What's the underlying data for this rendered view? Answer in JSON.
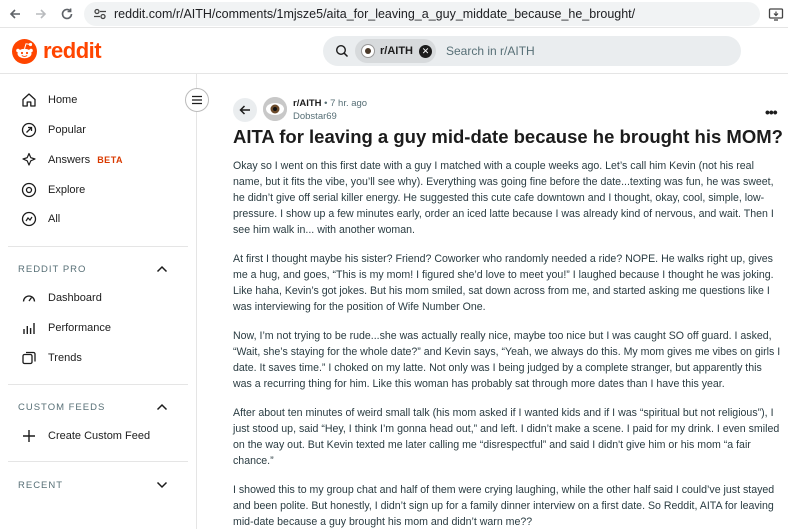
{
  "browser": {
    "url": "reddit.com/r/AITH/comments/1mjsze5/aita_for_leaving_a_guy_middate_because_he_brought/"
  },
  "header": {
    "logo_text": "reddit",
    "search_chip": "r/AITH",
    "search_placeholder": "Search in r/AITH"
  },
  "sidebar": {
    "items": [
      {
        "label": "Home",
        "icon": "home-icon"
      },
      {
        "label": "Popular",
        "icon": "popular-icon"
      },
      {
        "label": "Answers",
        "icon": "answers-icon",
        "badge": "BETA"
      },
      {
        "label": "Explore",
        "icon": "explore-icon"
      },
      {
        "label": "All",
        "icon": "all-icon"
      }
    ],
    "reddit_pro": {
      "heading": "REDDIT PRO",
      "items": [
        {
          "label": "Dashboard",
          "icon": "dashboard-icon"
        },
        {
          "label": "Performance",
          "icon": "performance-icon"
        },
        {
          "label": "Trends",
          "icon": "trends-icon"
        }
      ]
    },
    "custom_feeds": {
      "heading": "CUSTOM FEEDS",
      "create_label": "Create Custom Feed"
    },
    "recent": {
      "heading": "RECENT"
    }
  },
  "post": {
    "subreddit": "r/AITH",
    "separator": "•",
    "time": "7 hr. ago",
    "author": "Dobstar69",
    "title": "AITA for leaving a guy mid-date because he brought his MOM?",
    "paragraphs": [
      "Okay so I went on this first date with a guy I matched with a couple weeks ago. Let’s call him Kevin (not his real name, but it fits the vibe, you’ll see why). Everything was going fine before the date...texting was fun, he was sweet, he didn’t give off serial killer energy. He suggested this cute cafe downtown and I thought, okay, cool, simple, low-pressure. I show up a few minutes early, order an iced latte because I was already kind of nervous, and wait. Then I see him walk in... with another woman.",
      "At first I thought maybe his sister? Friend? Coworker who randomly needed a ride? NOPE. He walks right up, gives me a hug, and goes, “This is my mom! I figured she’d love to meet you!” I laughed because I thought he was joking. Like haha, Kevin’s got jokes. But his mom smiled, sat down across from me, and started asking me questions like I was interviewing for the position of Wife Number One.",
      "Now, I’m not trying to be rude...she was actually really nice, maybe too nice but I was caught SO off guard. I asked, “Wait, she’s staying for the whole date?” and Kevin says, “Yeah, we always do this. My mom gives me vibes on girls I date. It saves time.” I choked on my latte. Not only was I being judged by a complete stranger, but apparently this was a recurring thing for him. Like this woman has probably sat through more dates than I have this year.",
      "After about ten minutes of weird small talk (his mom asked if I wanted kids and if I was “spiritual but not religious”), I just stood up, said “Hey, I think I’m gonna head out,” and left. I didn’t make a scene. I paid for my drink. I even smiled on the way out. But Kevin texted me later calling me “disrespectful” and said I didn't give him or his mom “a fair chance.”",
      "I showed this to my group chat and half of them were crying laughing, while the other half said I could’ve just stayed and been polite. But honestly, I didn’t sign up for a family dinner interview on a first date. So Reddit, AITA for leaving mid-date because a guy brought his mom and didn’t warn me??"
    ]
  },
  "colors": {
    "brand": "#ff4500",
    "beta": "#d93a00",
    "muted": "#576f76"
  }
}
